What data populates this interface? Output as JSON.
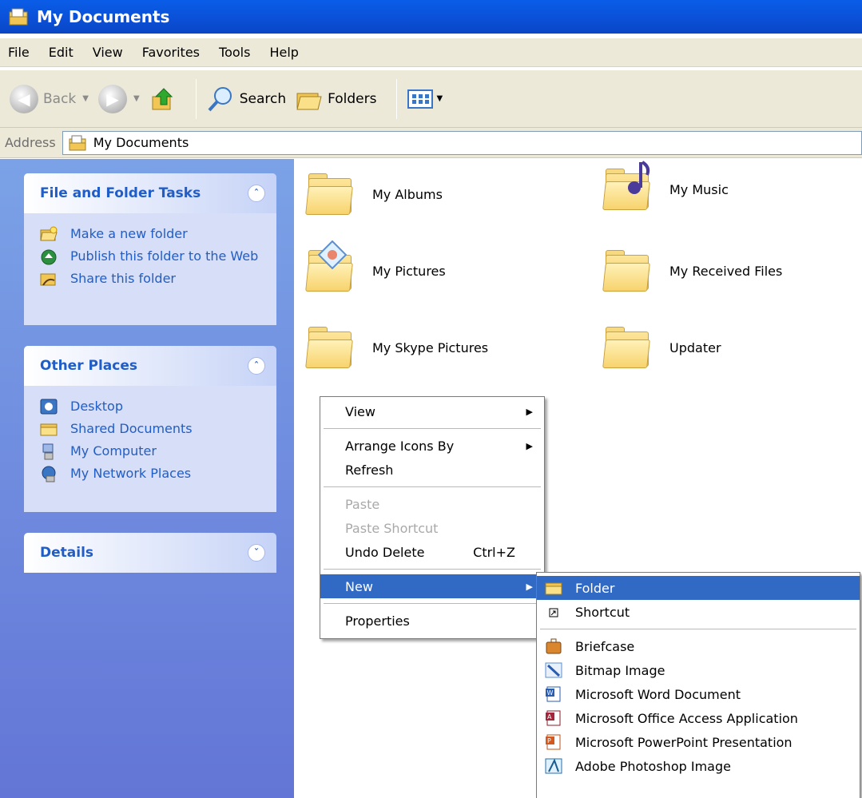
{
  "window": {
    "title": "My Documents"
  },
  "menubar": [
    "File",
    "Edit",
    "View",
    "Favorites",
    "Tools",
    "Help"
  ],
  "toolbar": {
    "back": "Back",
    "search": "Search",
    "folders": "Folders"
  },
  "address": {
    "label": "Address",
    "value": "My Documents"
  },
  "left_pane": {
    "tasks": {
      "title": "File and Folder Tasks",
      "items": [
        "Make a new folder",
        "Publish this folder to the Web",
        "Share this folder"
      ]
    },
    "places": {
      "title": "Other Places",
      "items": [
        "Desktop",
        "Shared Documents",
        "My Computer",
        "My Network Places"
      ]
    },
    "details": {
      "title": "Details"
    }
  },
  "folders": [
    "My Albums",
    "My Music",
    "My Pictures",
    "My Received Files",
    "My Skype Pictures",
    "Updater"
  ],
  "context_menu": {
    "view": "View",
    "arrange": "Arrange Icons By",
    "refresh": "Refresh",
    "paste": "Paste",
    "paste_shortcut": "Paste Shortcut",
    "undo": "Undo Delete",
    "undo_accel": "Ctrl+Z",
    "new": "New",
    "properties": "Properties"
  },
  "new_submenu": {
    "folder": "Folder",
    "shortcut": "Shortcut",
    "briefcase": "Briefcase",
    "bitmap": "Bitmap Image",
    "word": "Microsoft Word Document",
    "access": "Microsoft Office Access Application",
    "powerpoint": "Microsoft PowerPoint Presentation",
    "photoshop": "Adobe Photoshop Image"
  },
  "colors": {
    "title_bar": "#0a5de8",
    "menu_highlight": "#316ac5",
    "task_link": "#215dc6"
  }
}
